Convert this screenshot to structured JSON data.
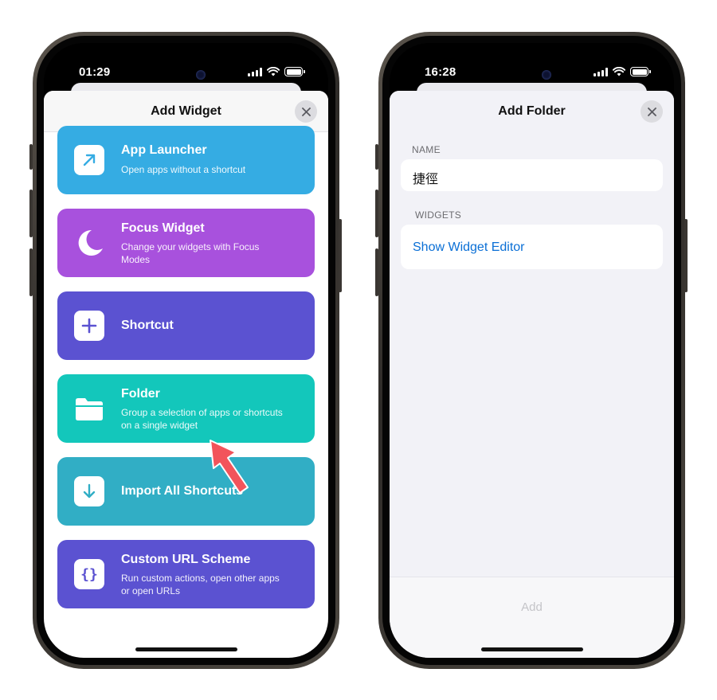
{
  "left_phone": {
    "time": "01:29",
    "sheet_title": "Add Widget",
    "cards": [
      {
        "title": "App Launcher",
        "subtitle_lines": [
          "Open apps without a shortcut"
        ],
        "color": "#35ace3",
        "icon": "arrow-up-right-icon"
      },
      {
        "title": "Focus Widget",
        "subtitle_lines": [
          "Change your widgets with Focus",
          "Modes"
        ],
        "color": "#a851dd",
        "icon": "moon-icon"
      },
      {
        "title": "Shortcut",
        "subtitle_lines": [],
        "color": "#5b52d1",
        "icon": "plus-icon"
      },
      {
        "title": "Folder",
        "subtitle_lines": [
          "Group a selection of apps or shortcuts",
          "on a single widget"
        ],
        "color": "#13c7bb",
        "icon": "folder-icon"
      },
      {
        "title": "Import All Shortcuts",
        "subtitle_lines": [],
        "color": "#31aec5",
        "icon": "arrow-down-icon"
      },
      {
        "title": "Custom URL Scheme",
        "subtitle_lines": [
          "Run custom actions, open other apps",
          "or open URLs"
        ],
        "color": "#5b52d1",
        "icon": "braces-icon"
      }
    ],
    "pointer_color": "#f2545b"
  },
  "right_phone": {
    "time": "16:28",
    "sheet_title": "Add Folder",
    "name_label": "NAME",
    "name_value": "捷徑",
    "widgets_label": "WIDGETS",
    "show_editor_label": "Show Widget Editor",
    "add_label": "Add",
    "link_color": "#0a6fd6"
  }
}
